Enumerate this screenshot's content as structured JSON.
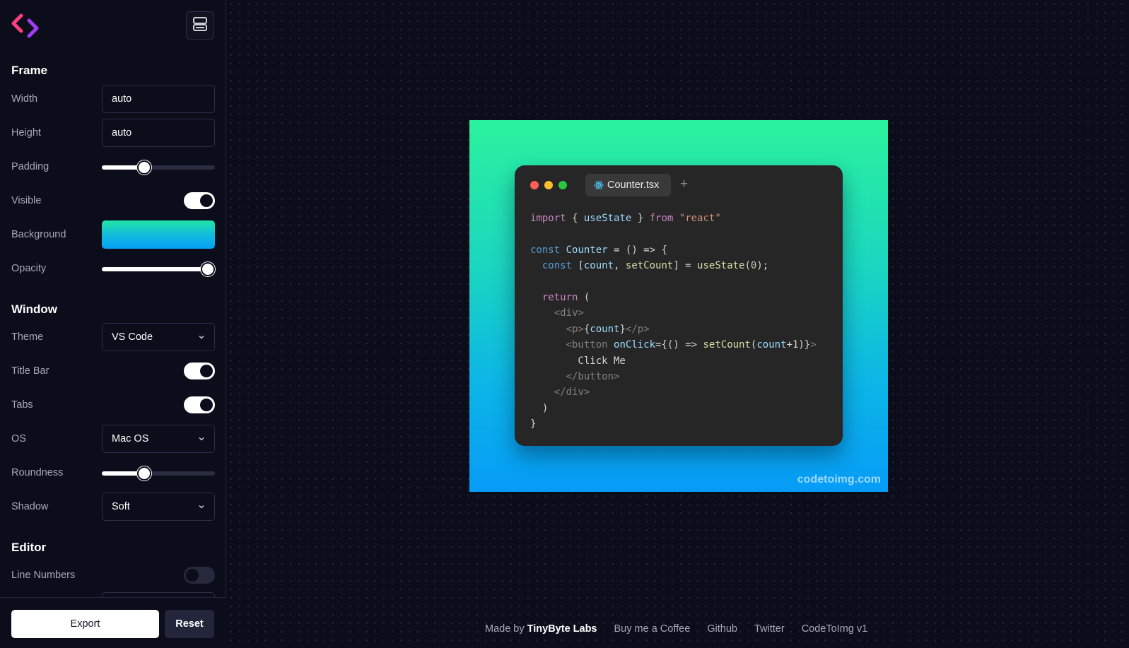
{
  "sidebar": {
    "logo_icon": "code-brackets-logo",
    "layout_toggle_icon": "layout-panels-icon",
    "frame": {
      "title": "Frame",
      "width_label": "Width",
      "width_value": "auto",
      "height_label": "Height",
      "height_value": "auto",
      "padding_label": "Padding",
      "padding_value": 0.36,
      "visible_label": "Visible",
      "visible_on": true,
      "background_label": "Background",
      "background_colors": [
        "#22e5a6",
        "#06a0f5"
      ],
      "opacity_label": "Opacity",
      "opacity_value": 1.0
    },
    "window": {
      "title": "Window",
      "theme_label": "Theme",
      "theme_value": "VS Code",
      "title_bar_label": "Title Bar",
      "title_bar_on": true,
      "tabs_label": "Tabs",
      "tabs_on": true,
      "os_label": "OS",
      "os_value": "Mac OS",
      "roundness_label": "Roundness",
      "roundness_value": 0.36,
      "shadow_label": "Shadow",
      "shadow_value": "Soft"
    },
    "editor": {
      "title": "Editor",
      "line_numbers_label": "Line Numbers",
      "line_numbers_on": false
    },
    "export_label": "Export",
    "reset_label": "Reset"
  },
  "preview": {
    "tab_name": "Counter.tsx",
    "tab_icon": "react-atom-icon",
    "new_tab_symbol": "+",
    "watermark": "codetoimg.com",
    "code_lines": [
      [
        [
          "import",
          "kw"
        ],
        [
          " { ",
          "p"
        ],
        [
          "useState",
          "id"
        ],
        [
          " } ",
          "p"
        ],
        [
          "from",
          "kw"
        ],
        [
          " ",
          "p"
        ],
        [
          "\"react\"",
          "str"
        ]
      ],
      [],
      [
        [
          "const",
          "dec"
        ],
        [
          " ",
          "p"
        ],
        [
          "Counter",
          "id"
        ],
        [
          " = () => {",
          "p"
        ]
      ],
      [
        [
          "  ",
          "p"
        ],
        [
          "const",
          "dec"
        ],
        [
          " [",
          "p"
        ],
        [
          "count",
          "id"
        ],
        [
          ", ",
          "p"
        ],
        [
          "setCount",
          "fn"
        ],
        [
          "] = ",
          "p"
        ],
        [
          "useState",
          "fn"
        ],
        [
          "(",
          "p"
        ],
        [
          "0",
          "num"
        ],
        [
          ");",
          "p"
        ]
      ],
      [],
      [
        [
          "  ",
          "p"
        ],
        [
          "return",
          "kw"
        ],
        [
          " (",
          "p"
        ]
      ],
      [
        [
          "    ",
          "p"
        ],
        [
          "<div>",
          "tag"
        ]
      ],
      [
        [
          "      ",
          "p"
        ],
        [
          "<p>",
          "tag"
        ],
        [
          "{",
          "p"
        ],
        [
          "count",
          "id"
        ],
        [
          "}",
          "p"
        ],
        [
          "</p>",
          "tag"
        ]
      ],
      [
        [
          "      ",
          "p"
        ],
        [
          "<button",
          "tag"
        ],
        [
          " ",
          "p"
        ],
        [
          "onClick",
          "attr"
        ],
        [
          "={() => ",
          "p"
        ],
        [
          "setCount",
          "fn"
        ],
        [
          "(",
          "p"
        ],
        [
          "count",
          "id"
        ],
        [
          "+1)}",
          "p"
        ],
        [
          ">",
          "tag"
        ]
      ],
      [
        [
          "        Click Me",
          "txt"
        ]
      ],
      [
        [
          "      ",
          "p"
        ],
        [
          "</button>",
          "tag"
        ]
      ],
      [
        [
          "    ",
          "p"
        ],
        [
          "</div>",
          "tag"
        ]
      ],
      [
        [
          "  )",
          "p"
        ]
      ],
      [
        [
          "}",
          "p"
        ]
      ]
    ],
    "code_colors": {
      "kw": "#c586c0",
      "dec": "#569cd6",
      "id": "#9cdcfe",
      "fn": "#dcdcaa",
      "str": "#ce9178",
      "num": "#b5cea8",
      "tag": "#808080",
      "attr": "#9cdcfe",
      "txt": "#d4d4d4",
      "p": "#d4d4d4"
    }
  },
  "footer": {
    "made_by_prefix": "Made by",
    "made_by_name": "TinyByte Labs",
    "coffee": "Buy me a Coffee",
    "github": "Github",
    "twitter": "Twitter",
    "version": "CodeToImg v1"
  }
}
